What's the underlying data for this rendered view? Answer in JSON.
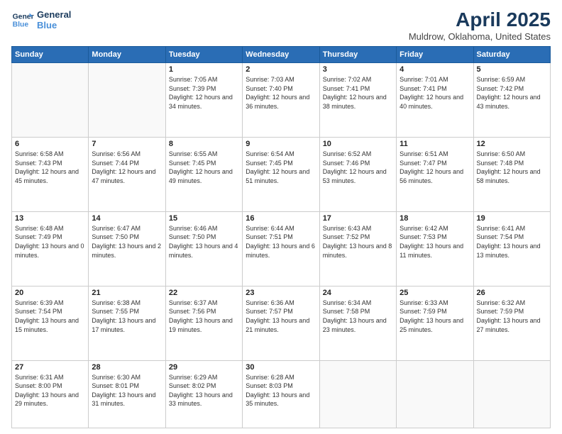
{
  "header": {
    "logo_line1": "General",
    "logo_line2": "Blue",
    "month": "April 2025",
    "location": "Muldrow, Oklahoma, United States"
  },
  "weekdays": [
    "Sunday",
    "Monday",
    "Tuesday",
    "Wednesday",
    "Thursday",
    "Friday",
    "Saturday"
  ],
  "weeks": [
    [
      {
        "day": "",
        "info": ""
      },
      {
        "day": "",
        "info": ""
      },
      {
        "day": "1",
        "info": "Sunrise: 7:05 AM\nSunset: 7:39 PM\nDaylight: 12 hours and 34 minutes."
      },
      {
        "day": "2",
        "info": "Sunrise: 7:03 AM\nSunset: 7:40 PM\nDaylight: 12 hours and 36 minutes."
      },
      {
        "day": "3",
        "info": "Sunrise: 7:02 AM\nSunset: 7:41 PM\nDaylight: 12 hours and 38 minutes."
      },
      {
        "day": "4",
        "info": "Sunrise: 7:01 AM\nSunset: 7:41 PM\nDaylight: 12 hours and 40 minutes."
      },
      {
        "day": "5",
        "info": "Sunrise: 6:59 AM\nSunset: 7:42 PM\nDaylight: 12 hours and 43 minutes."
      }
    ],
    [
      {
        "day": "6",
        "info": "Sunrise: 6:58 AM\nSunset: 7:43 PM\nDaylight: 12 hours and 45 minutes."
      },
      {
        "day": "7",
        "info": "Sunrise: 6:56 AM\nSunset: 7:44 PM\nDaylight: 12 hours and 47 minutes."
      },
      {
        "day": "8",
        "info": "Sunrise: 6:55 AM\nSunset: 7:45 PM\nDaylight: 12 hours and 49 minutes."
      },
      {
        "day": "9",
        "info": "Sunrise: 6:54 AM\nSunset: 7:45 PM\nDaylight: 12 hours and 51 minutes."
      },
      {
        "day": "10",
        "info": "Sunrise: 6:52 AM\nSunset: 7:46 PM\nDaylight: 12 hours and 53 minutes."
      },
      {
        "day": "11",
        "info": "Sunrise: 6:51 AM\nSunset: 7:47 PM\nDaylight: 12 hours and 56 minutes."
      },
      {
        "day": "12",
        "info": "Sunrise: 6:50 AM\nSunset: 7:48 PM\nDaylight: 12 hours and 58 minutes."
      }
    ],
    [
      {
        "day": "13",
        "info": "Sunrise: 6:48 AM\nSunset: 7:49 PM\nDaylight: 13 hours and 0 minutes."
      },
      {
        "day": "14",
        "info": "Sunrise: 6:47 AM\nSunset: 7:50 PM\nDaylight: 13 hours and 2 minutes."
      },
      {
        "day": "15",
        "info": "Sunrise: 6:46 AM\nSunset: 7:50 PM\nDaylight: 13 hours and 4 minutes."
      },
      {
        "day": "16",
        "info": "Sunrise: 6:44 AM\nSunset: 7:51 PM\nDaylight: 13 hours and 6 minutes."
      },
      {
        "day": "17",
        "info": "Sunrise: 6:43 AM\nSunset: 7:52 PM\nDaylight: 13 hours and 8 minutes."
      },
      {
        "day": "18",
        "info": "Sunrise: 6:42 AM\nSunset: 7:53 PM\nDaylight: 13 hours and 11 minutes."
      },
      {
        "day": "19",
        "info": "Sunrise: 6:41 AM\nSunset: 7:54 PM\nDaylight: 13 hours and 13 minutes."
      }
    ],
    [
      {
        "day": "20",
        "info": "Sunrise: 6:39 AM\nSunset: 7:54 PM\nDaylight: 13 hours and 15 minutes."
      },
      {
        "day": "21",
        "info": "Sunrise: 6:38 AM\nSunset: 7:55 PM\nDaylight: 13 hours and 17 minutes."
      },
      {
        "day": "22",
        "info": "Sunrise: 6:37 AM\nSunset: 7:56 PM\nDaylight: 13 hours and 19 minutes."
      },
      {
        "day": "23",
        "info": "Sunrise: 6:36 AM\nSunset: 7:57 PM\nDaylight: 13 hours and 21 minutes."
      },
      {
        "day": "24",
        "info": "Sunrise: 6:34 AM\nSunset: 7:58 PM\nDaylight: 13 hours and 23 minutes."
      },
      {
        "day": "25",
        "info": "Sunrise: 6:33 AM\nSunset: 7:59 PM\nDaylight: 13 hours and 25 minutes."
      },
      {
        "day": "26",
        "info": "Sunrise: 6:32 AM\nSunset: 7:59 PM\nDaylight: 13 hours and 27 minutes."
      }
    ],
    [
      {
        "day": "27",
        "info": "Sunrise: 6:31 AM\nSunset: 8:00 PM\nDaylight: 13 hours and 29 minutes."
      },
      {
        "day": "28",
        "info": "Sunrise: 6:30 AM\nSunset: 8:01 PM\nDaylight: 13 hours and 31 minutes."
      },
      {
        "day": "29",
        "info": "Sunrise: 6:29 AM\nSunset: 8:02 PM\nDaylight: 13 hours and 33 minutes."
      },
      {
        "day": "30",
        "info": "Sunrise: 6:28 AM\nSunset: 8:03 PM\nDaylight: 13 hours and 35 minutes."
      },
      {
        "day": "",
        "info": ""
      },
      {
        "day": "",
        "info": ""
      },
      {
        "day": "",
        "info": ""
      }
    ]
  ]
}
